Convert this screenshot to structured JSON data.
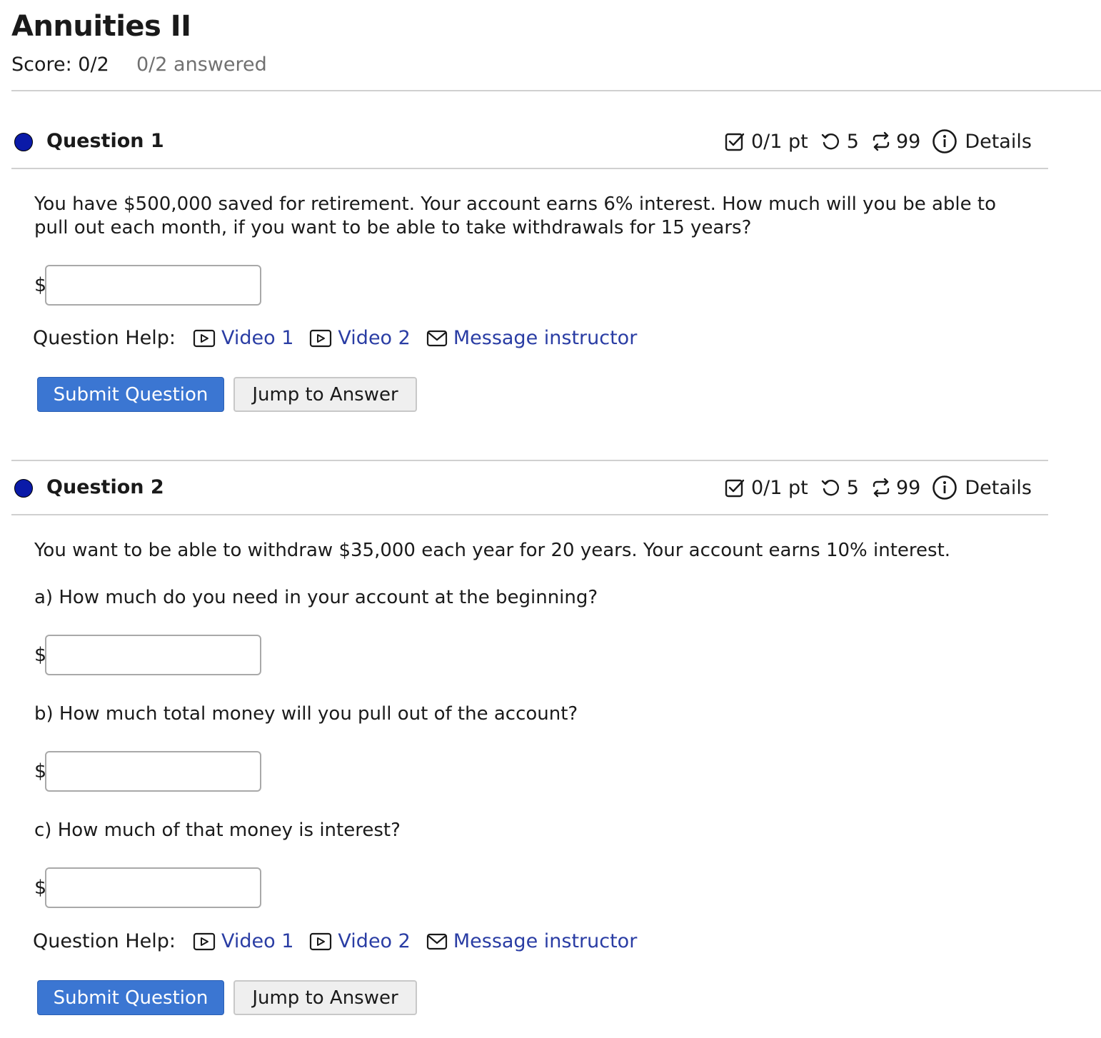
{
  "page": {
    "title": "Annuities II",
    "score": "Score: 0/2",
    "answered": "0/2 answered"
  },
  "questions": [
    {
      "title": "Question 1",
      "points": "0/1 pt",
      "retries": "5",
      "attempts": "99",
      "details": "Details",
      "prompt": "You have $500,000 saved for retirement. Your account earns 6% interest. How much will you be able to pull out each month, if you want to be able to take withdrawals for 15 years?",
      "answers": [
        {
          "prefix": "$",
          "value": ""
        }
      ],
      "help": {
        "label": "Question Help:",
        "video1": "Video 1",
        "video2": "Video 2",
        "message": "Message instructor"
      },
      "submit": "Submit Question",
      "jump": "Jump to Answer"
    },
    {
      "title": "Question 2",
      "points": "0/1 pt",
      "retries": "5",
      "attempts": "99",
      "details": "Details",
      "prompt": "You want to be able to withdraw $35,000 each year for 20 years. Your account earns 10% interest.",
      "parts": [
        {
          "text": "a) How much do you need in your account at the beginning?",
          "prefix": "$",
          "value": ""
        },
        {
          "text": "b) How much total money will you pull out of the account?",
          "prefix": "$",
          "value": ""
        },
        {
          "text": "c) How much of that money is interest?",
          "prefix": "$",
          "value": ""
        }
      ],
      "help": {
        "label": "Question Help:",
        "video1": "Video 1",
        "video2": "Video 2",
        "message": "Message instructor"
      },
      "submit": "Submit Question",
      "jump": "Jump to Answer"
    }
  ],
  "icons": {
    "points": "checkbox-icon",
    "retries": "retry-icon",
    "attempts": "repeat-icon",
    "details": "info-icon",
    "video": "video-icon",
    "message": "envelope-icon"
  },
  "colors": {
    "status_dot": "#0a1aa8",
    "link": "#2a3da4",
    "submit_bg": "#3b76d2",
    "divider": "#d0d0d0"
  }
}
